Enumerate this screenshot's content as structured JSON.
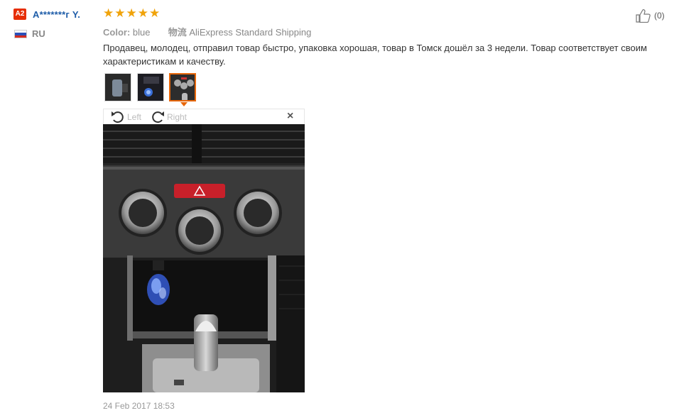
{
  "user": {
    "level_badge": "A2",
    "name": "A*******г Y.",
    "country": "RU"
  },
  "review": {
    "rating": 5,
    "stars": [
      "★",
      "★",
      "★",
      "★",
      "★"
    ],
    "color_key": "Color:",
    "color_value": "blue",
    "shipping_key": "物流",
    "shipping_value": "AliExpress Standard Shipping",
    "text": "Продавец, молодец, отправил товар быстро, упаковка хорошая, товар в Томск дошёл за 3 недели. Товар соответствует своим характеристикам и качеству.",
    "timestamp": "24 Feb 2017 18:53"
  },
  "helpful": {
    "icon": "thumbs-up-icon",
    "count": "(0)"
  },
  "viewer": {
    "rotate_left": "Left",
    "rotate_right": "Right",
    "close": "×",
    "selected_thumb": 3
  },
  "colors": {
    "badge": "#e62e04",
    "stars": "#f0a30a",
    "accent": "#e8670b",
    "username": "#1d5ca8"
  }
}
